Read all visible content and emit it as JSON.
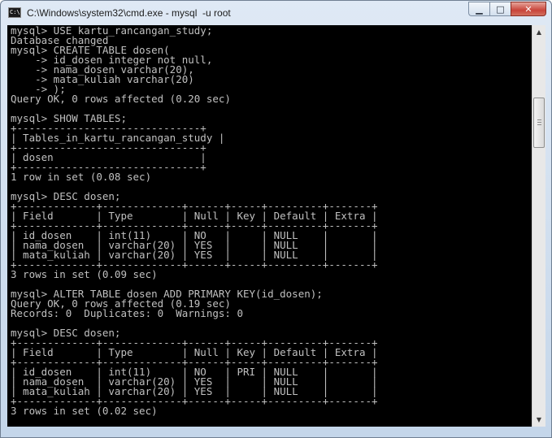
{
  "window": {
    "title": "C:\\Windows\\system32\\cmd.exe - mysql  -u root",
    "app_icon_text": "C:\\",
    "buttons": {
      "minimize": "▁",
      "maximize": "□",
      "close": "✕"
    }
  },
  "console": {
    "lines": [
      "mysql> USE kartu_rancangan_study;",
      "Database changed",
      "mysql> CREATE TABLE dosen(",
      "    -> id_dosen integer not null,",
      "    -> nama_dosen varchar(20),",
      "    -> mata_kuliah varchar(20)",
      "    -> );",
      "Query OK, 0 rows affected (0.20 sec)",
      "",
      "mysql> SHOW TABLES;",
      "+------------------------------+",
      "| Tables_in_kartu_rancangan_study |",
      "+------------------------------+",
      "| dosen                        |",
      "+------------------------------+",
      "1 row in set (0.08 sec)",
      "",
      "mysql> DESC dosen;",
      "+-------------+-------------+------+-----+---------+-------+",
      "| Field       | Type        | Null | Key | Default | Extra |",
      "+-------------+-------------+------+-----+---------+-------+",
      "| id_dosen    | int(11)     | NO   |     | NULL    |       |",
      "| nama_dosen  | varchar(20) | YES  |     | NULL    |       |",
      "| mata_kuliah | varchar(20) | YES  |     | NULL    |       |",
      "+-------------+-------------+------+-----+---------+-------+",
      "3 rows in set (0.09 sec)",
      "",
      "mysql> ALTER TABLE dosen ADD PRIMARY KEY(id_dosen);",
      "Query OK, 0 rows affected (0.19 sec)",
      "Records: 0  Duplicates: 0  Warnings: 0",
      "",
      "mysql> DESC dosen;",
      "+-------------+-------------+------+-----+---------+-------+",
      "| Field       | Type        | Null | Key | Default | Extra |",
      "+-------------+-------------+------+-----+---------+-------+",
      "| id_dosen    | int(11)     | NO   | PRI | NULL    |       |",
      "| nama_dosen  | varchar(20) | YES  |     | NULL    |       |",
      "| mata_kuliah | varchar(20) | YES  |     | NULL    |       |",
      "+-------------+-------------+------+-----+---------+-------+",
      "3 rows in set (0.02 sec)",
      ""
    ]
  },
  "scrollbar": {
    "up_arrow": "▲",
    "down_arrow": "▼",
    "position": 0.18
  },
  "colors": {
    "console_bg": "#000000",
    "console_fg": "#c0c0c0",
    "close_button": "#c8443a",
    "title_gradient_top": "#dfe9f5"
  },
  "icons": [
    "app-icon",
    "minimize-icon",
    "maximize-icon",
    "close-icon",
    "scroll-up-arrow-icon",
    "scroll-down-arrow-icon"
  ]
}
